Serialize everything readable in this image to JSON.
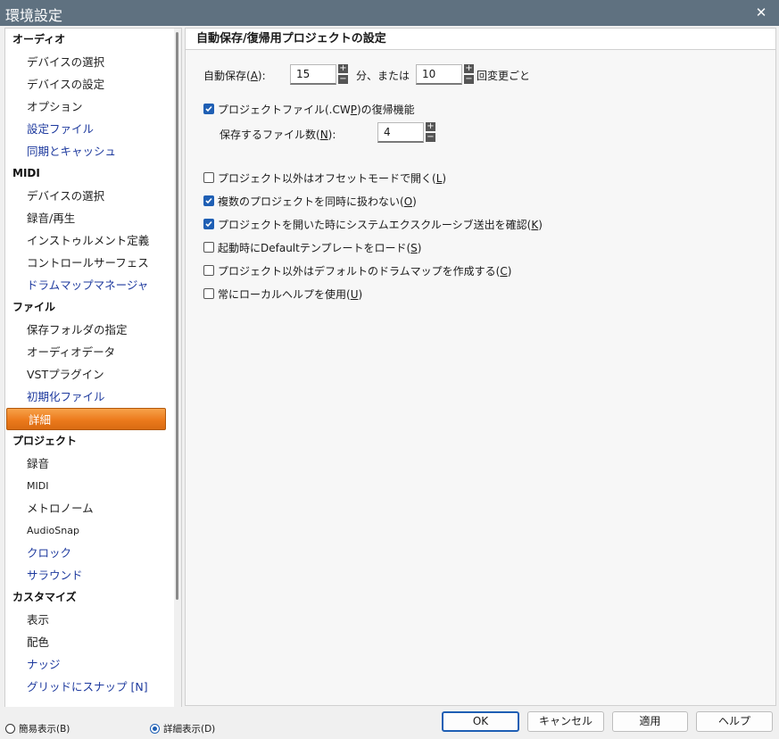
{
  "window": {
    "title": "環境設定",
    "close_glyph": "✕"
  },
  "sidebar": {
    "items": [
      {
        "label": "オーディオ",
        "kind": "category"
      },
      {
        "label": "デバイスの選択",
        "kind": "child"
      },
      {
        "label": "デバイスの設定",
        "kind": "child"
      },
      {
        "label": "オプション",
        "kind": "child"
      },
      {
        "label": "設定ファイル",
        "kind": "child",
        "style": "link"
      },
      {
        "label": "同期とキャッシュ",
        "kind": "child",
        "style": "link"
      },
      {
        "label": "MIDI",
        "kind": "category"
      },
      {
        "label": "デバイスの選択",
        "kind": "child"
      },
      {
        "label": "録音/再生",
        "kind": "child"
      },
      {
        "label": "インストゥルメント定義",
        "kind": "child"
      },
      {
        "label": "コントロールサーフェス",
        "kind": "child"
      },
      {
        "label": "ドラムマップマネージャ",
        "kind": "child",
        "style": "link"
      },
      {
        "label": "ファイル",
        "kind": "category"
      },
      {
        "label": "保存フォルダの指定",
        "kind": "child"
      },
      {
        "label": "オーディオデータ",
        "kind": "child"
      },
      {
        "label": "VSTプラグイン",
        "kind": "child"
      },
      {
        "label": "初期化ファイル",
        "kind": "child",
        "style": "link"
      },
      {
        "label": "詳細",
        "kind": "child",
        "selected": true
      },
      {
        "label": "プロジェクト",
        "kind": "category"
      },
      {
        "label": "録音",
        "kind": "child"
      },
      {
        "label": "MIDI",
        "kind": "child",
        "style": "small"
      },
      {
        "label": "メトロノーム",
        "kind": "child"
      },
      {
        "label": "AudioSnap",
        "kind": "child",
        "style": "small"
      },
      {
        "label": "クロック",
        "kind": "child",
        "style": "link"
      },
      {
        "label": "サラウンド",
        "kind": "child",
        "style": "link"
      },
      {
        "label": "カスタマイズ",
        "kind": "category"
      },
      {
        "label": "表示",
        "kind": "child"
      },
      {
        "label": "配色",
        "kind": "child"
      },
      {
        "label": "ナッジ",
        "kind": "child",
        "style": "link"
      },
      {
        "label": "グリッドにスナップ [N]",
        "kind": "child",
        "style": "link"
      }
    ]
  },
  "panel": {
    "header": "自動保存/復帰用プロジェクトの設定",
    "autosave": {
      "label_pre": "自動保存(",
      "label_key": "A",
      "label_post": "):",
      "minutes_value": "15",
      "between_text": "分、または",
      "changes_value": "10",
      "suffix_text": "回変更ごと"
    },
    "recovery": {
      "checked": true,
      "label_pre": "プロジェクトファイル(.CW",
      "label_key": "P",
      "label_post": ")の復帰機能",
      "count_label_pre": "保存するファイル数(",
      "count_label_key": "N",
      "count_label_post": "):",
      "count_value": "4"
    },
    "options": [
      {
        "checked": false,
        "pre": "プロジェクト以外はオフセットモードで開く(",
        "key": "L",
        "post": ")"
      },
      {
        "checked": true,
        "pre": "複数のプロジェクトを同時に扱わない(",
        "key": "O",
        "post": ")"
      },
      {
        "checked": true,
        "pre": "プロジェクトを開いた時にシステムエクスクルーシブ送出を確認(",
        "key": "K",
        "post": ")"
      },
      {
        "checked": false,
        "pre": "起動時にDefaultテンプレートをロード(",
        "key": "S",
        "post": ")"
      },
      {
        "checked": false,
        "pre": "プロジェクト以外はデフォルトのドラムマップを作成する(",
        "key": "C",
        "post": ")"
      },
      {
        "checked": false,
        "pre": "常にローカルヘルプを使用(",
        "key": "U",
        "post": ")"
      }
    ]
  },
  "bottom": {
    "simple_view": {
      "label": "簡易表示(B)",
      "selected": false
    },
    "detail_view": {
      "label": "詳細表示(D)",
      "selected": true
    },
    "ok": "OK",
    "cancel": "キャンセル",
    "apply": "適用",
    "help": "ヘルプ"
  },
  "colors": {
    "titlebar": "#5f7180",
    "selection": "#ec7a1c",
    "accent": "#1f5fb4",
    "link": "#1e3a9e"
  },
  "icons": {
    "close": "close-icon",
    "spin_up": "plus-icon",
    "spin_down": "minus-icon",
    "check": "checkmark-icon"
  }
}
